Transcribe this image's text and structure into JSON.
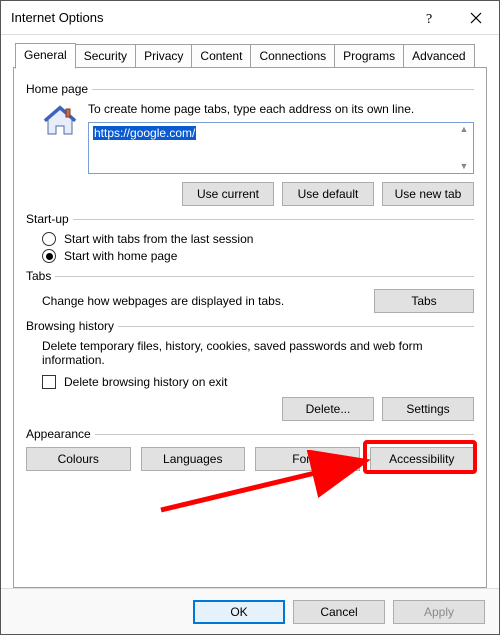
{
  "title": "Internet Options",
  "tabs": [
    "General",
    "Security",
    "Privacy",
    "Content",
    "Connections",
    "Programs",
    "Advanced"
  ],
  "active_tab": 0,
  "homepage": {
    "group_label": "Home page",
    "instruction": "To create home page tabs, type each address on its own line.",
    "url_value": "https://google.com/",
    "buttons": {
      "use_current": "Use current",
      "use_default": "Use default",
      "use_new_tab": "Use new tab"
    }
  },
  "startup": {
    "group_label": "Start-up",
    "option_last_session": "Start with tabs from the last session",
    "option_home_page": "Start with home page",
    "selected": "home_page"
  },
  "tabs_group": {
    "group_label": "Tabs",
    "text": "Change how webpages are displayed in tabs.",
    "button": "Tabs"
  },
  "history": {
    "group_label": "Browsing history",
    "text": "Delete temporary files, history, cookies, saved passwords and web form information.",
    "checkbox_label": "Delete browsing history on exit",
    "checked": false,
    "buttons": {
      "delete": "Delete...",
      "settings": "Settings"
    }
  },
  "appearance": {
    "group_label": "Appearance",
    "buttons": {
      "colours": "Colours",
      "languages": "Languages",
      "fonts": "Fonts",
      "accessibility": "Accessibility"
    }
  },
  "footer": {
    "ok": "OK",
    "cancel": "Cancel",
    "apply": "Apply"
  },
  "annotations": {
    "highlighted": "accessibility-button"
  }
}
